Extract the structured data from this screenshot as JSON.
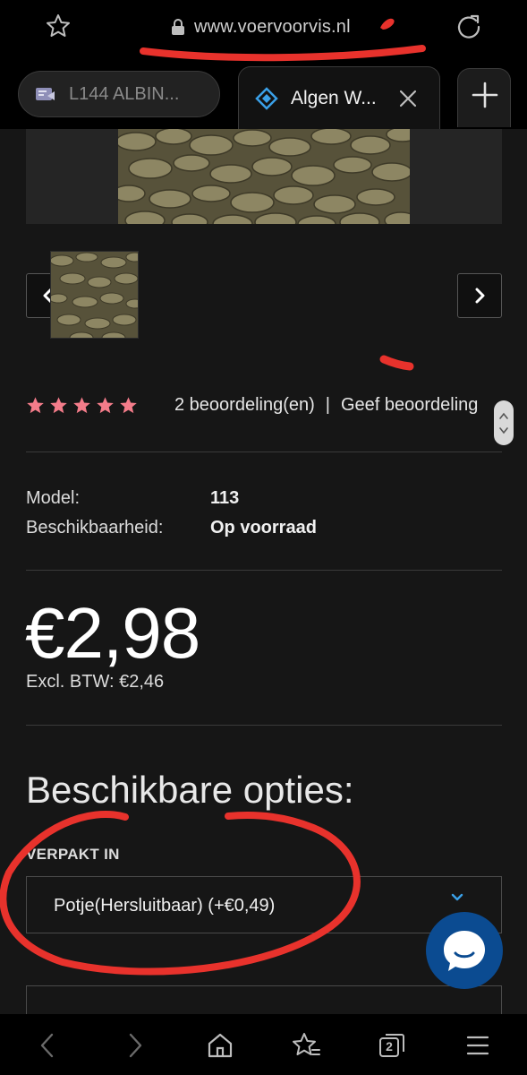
{
  "browser": {
    "url": "www.voervoorvis.nl",
    "tabs": [
      {
        "title": "L144 ALBIN..."
      },
      {
        "title": "Algen W..."
      }
    ],
    "tab_count": "2"
  },
  "product": {
    "rating_stars": 5,
    "review_count": "2 beoordeling(en)",
    "separator": "|",
    "write_review": "Geef beoordeling",
    "specs": [
      {
        "label": "Model:",
        "value": "113"
      },
      {
        "label": "Beschikbaarheid:",
        "value": "Op voorraad"
      }
    ],
    "price": "€2,98",
    "price_excl": "Excl. BTW: €2,46"
  },
  "options": {
    "heading": "Beschikbare opties:",
    "packaging_label": "VERPAKT IN",
    "packaging_selected": "Potje(Hersluitbaar) (+€0,49)"
  },
  "colors": {
    "background": "#161616",
    "star": "#f47c8a",
    "chat_button": "#0b4b91",
    "marker": "#e8322c"
  }
}
